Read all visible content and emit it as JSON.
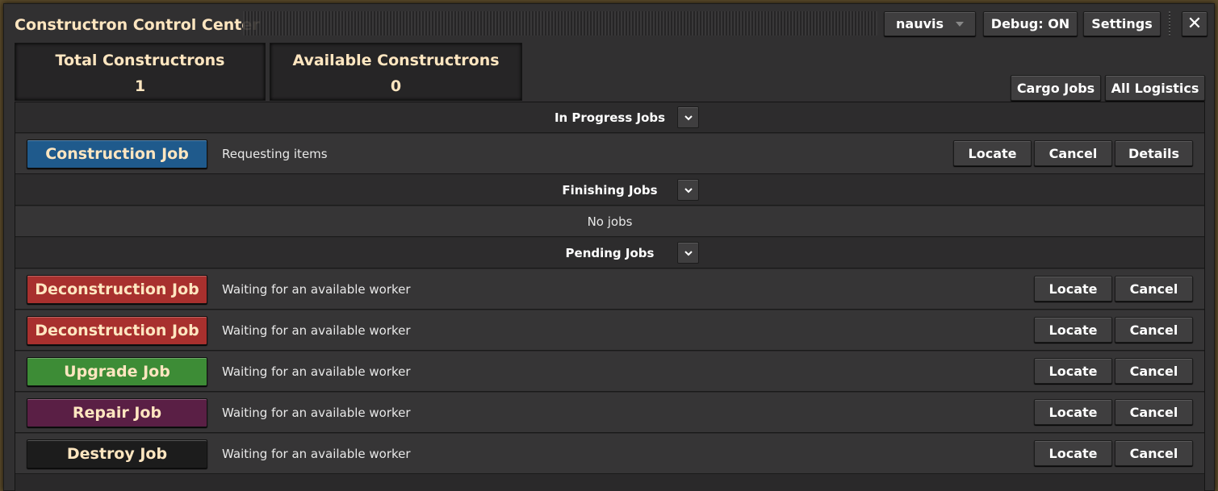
{
  "window": {
    "title": "Constructron Control Center",
    "surface_dropdown": "nauvis",
    "debug_label": "Debug: ON",
    "settings_label": "Settings",
    "close_glyph": "✕"
  },
  "stats": {
    "total_label": "Total Constructrons",
    "total_value": "1",
    "available_label": "Available Constructrons",
    "available_value": "0"
  },
  "toolbar": {
    "cargo_jobs": "Cargo Jobs",
    "all_logistics": "All Logistics"
  },
  "sections": {
    "in_progress": {
      "title": "In Progress Jobs",
      "jobs": [
        {
          "label": "Construction Job",
          "status": "Requesting items",
          "color": "#1f5a8c",
          "locate": "Locate",
          "cancel": "Cancel",
          "details": "Details"
        }
      ]
    },
    "finishing": {
      "title": "Finishing Jobs",
      "empty_text": "No jobs"
    },
    "pending": {
      "title": "Pending Jobs",
      "jobs": [
        {
          "label": "Deconstruction Job",
          "status": "Waiting for an available worker",
          "color": "#a8302e",
          "locate": "Locate",
          "cancel": "Cancel"
        },
        {
          "label": "Deconstruction Job",
          "status": "Waiting for an available worker",
          "color": "#a8302e",
          "locate": "Locate",
          "cancel": "Cancel"
        },
        {
          "label": "Upgrade Job",
          "status": "Waiting for an available worker",
          "color": "#3d8c36",
          "locate": "Locate",
          "cancel": "Cancel"
        },
        {
          "label": "Repair Job",
          "status": "Waiting for an available worker",
          "color": "#5a1f45",
          "locate": "Locate",
          "cancel": "Cancel"
        },
        {
          "label": "Destroy Job",
          "status": "Waiting for an available worker",
          "color": "#1c1c1c",
          "locate": "Locate",
          "cancel": "Cancel"
        }
      ]
    }
  },
  "icons": {
    "chevron": "chevron-down-icon",
    "dropdown_caret": "caret-down-icon",
    "close": "close-icon"
  }
}
